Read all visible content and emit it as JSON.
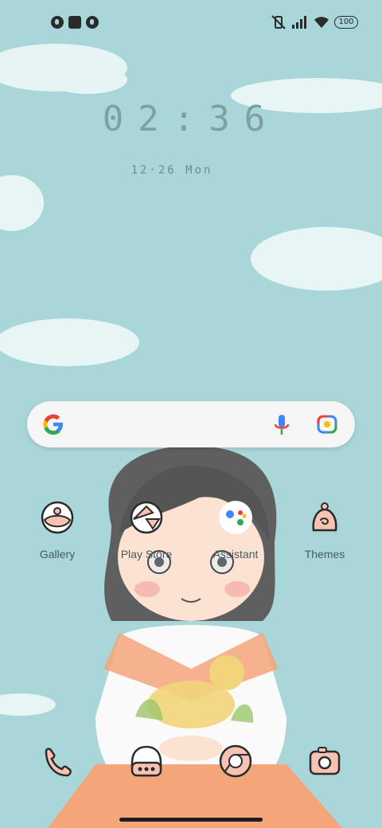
{
  "status_bar": {
    "left_icons": [
      "notification-icon-1",
      "notification-square-icon",
      "notification-icon-2"
    ],
    "right_icons": [
      "vibrate-off-icon",
      "signal-icon",
      "wifi-icon"
    ],
    "battery": "100"
  },
  "clock": {
    "time": "02:36",
    "date": "12·26 Mon"
  },
  "search": {
    "icons": [
      "google-g-icon",
      "mic-icon",
      "lens-icon"
    ]
  },
  "apps_row1": [
    {
      "label": "Gallery",
      "icon": "gallery-icon"
    },
    {
      "label": "Play Store",
      "icon": "play-store-icon"
    },
    {
      "label": "Assistant",
      "icon": "assistant-icon"
    },
    {
      "label": "Themes",
      "icon": "themes-icon"
    }
  ],
  "dock": [
    {
      "icon": "phone-icon"
    },
    {
      "icon": "messages-icon"
    },
    {
      "icon": "chrome-icon"
    },
    {
      "icon": "camera-icon"
    }
  ],
  "colors": {
    "sky": "#a9d6d8",
    "icon_fill": "#f7c2b3",
    "icon_stroke": "#2b2b2b",
    "label_text": "#4a5a5a",
    "clock_text": "#7f9fa0"
  }
}
